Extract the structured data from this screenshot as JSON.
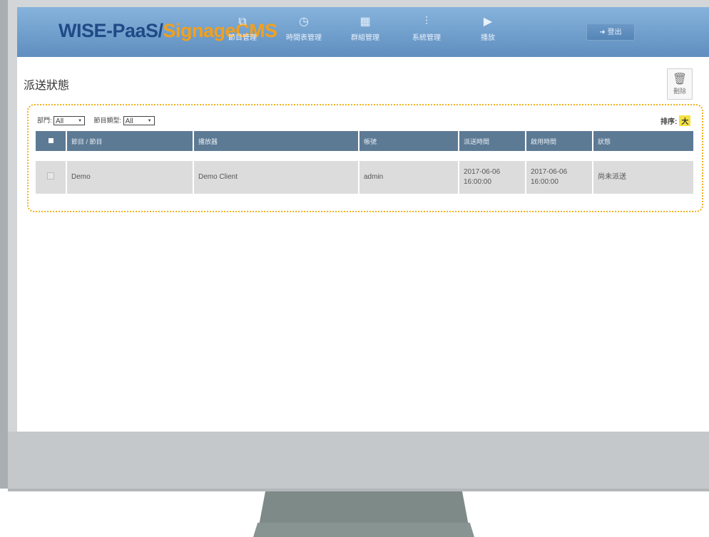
{
  "app": {
    "logo_part1": "WISE-PaaS/",
    "logo_part2": "SignageCMS"
  },
  "nav": [
    {
      "icon": "⧉",
      "label": "節目管理"
    },
    {
      "icon": "◷",
      "label": "時間表管理"
    },
    {
      "icon": "▦",
      "label": "群組管理"
    },
    {
      "icon": "⫶",
      "label": "系統管理"
    },
    {
      "icon": "▶",
      "label": "播放"
    }
  ],
  "logout": {
    "icon": "➜",
    "label": "登出"
  },
  "page": {
    "title": "派送狀態"
  },
  "delete_button": {
    "icon": "🗑",
    "label": "刪除"
  },
  "filters": {
    "dept_label": "部門:",
    "dept_value": "All",
    "type_label": "節目類型:",
    "type_value": "All"
  },
  "sort": {
    "label": "排序:",
    "value": "大"
  },
  "table": {
    "headers": [
      "節目 / 節目",
      "播放器",
      "帳號",
      "派送時間",
      "啟用時間",
      "狀態"
    ],
    "rows": [
      {
        "name": "Demo",
        "client": "Demo Client",
        "account": "admin",
        "send_time": "2017-06-06 16:00:00",
        "enable_time": "2017-06-06 16:00:00",
        "status": "尚未派送"
      }
    ]
  }
}
